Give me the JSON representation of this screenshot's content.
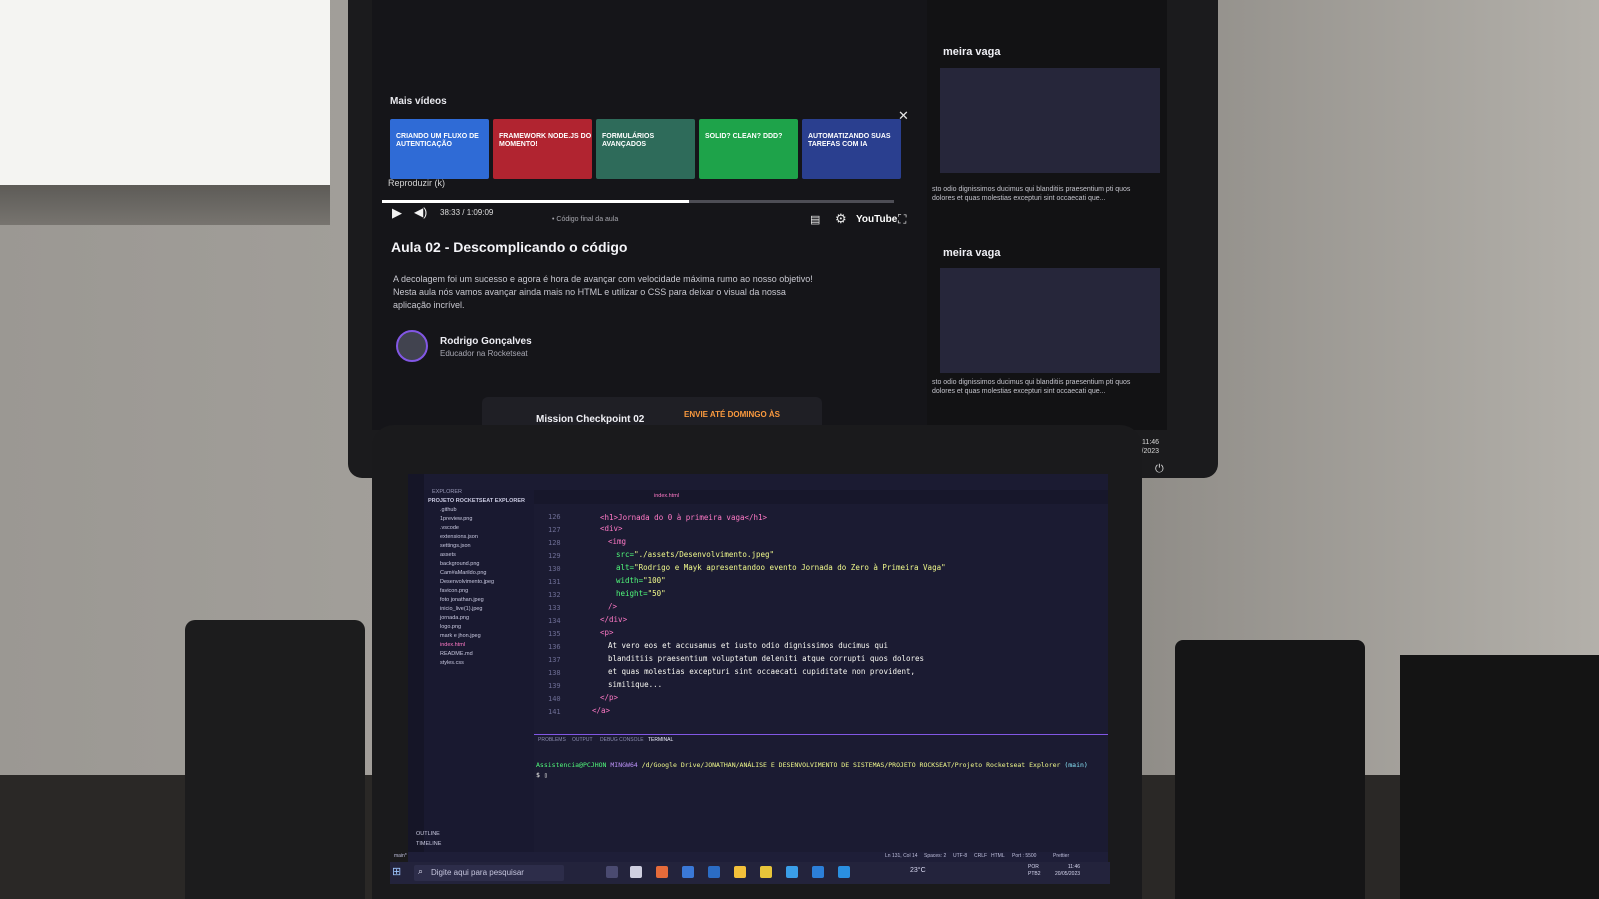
{
  "player": {
    "more_videos": "Mais vídeos",
    "close": "✕",
    "thumbs": [
      {
        "text": "CRIANDO UM FLUXO DE AUTENTICAÇÃO",
        "color": "#2f6bd6"
      },
      {
        "text": "FRAMEWORK NODE.JS DO MOMENTO!",
        "color": "#b12430"
      },
      {
        "text": "FORMULÁRIOS AVANÇADOS",
        "color": "#2e6b5a"
      },
      {
        "text": "SOLID? CLEAN? DDD?",
        "color": "#1ea34a"
      },
      {
        "text": "AUTOMATIZANDO SUAS TAREFAS COM IA",
        "color": "#2a3f8f"
      }
    ],
    "replay": "Reproduzir (k)",
    "progress": 0.6,
    "time": "38:33 / 1:09:09",
    "chapter": "• Código final da aula",
    "brand": "YouTube"
  },
  "lesson": {
    "title": "Aula 02 - Descomplicando o código",
    "description": "A decolagem foi um sucesso e agora é hora de avançar com velocidade máxima rumo ao nosso objetivo! Nesta aula nós vamos avançar ainda mais no HTML e utilizar o CSS para deixar o visual da nossa aplicação incrível.",
    "author": "Rodrigo Gonçalves",
    "role": "Educador na Rocketseat",
    "mission": "Mission Checkpoint 02",
    "badge": "ENVIE ATÉ DOMINGO ÀS"
  },
  "side": {
    "head1": "meira vaga",
    "text1": "sto odio dignissimos ducimus qui blanditiis praesentium pti quos dolores et quas molestias excepturi sint occaecati que...",
    "head2": "meira vaga",
    "text2": "sto odio dignissimos ducimus qui blanditiis praesentium pti quos dolores et quas molestias excepturi sint occaecati que...",
    "time": "11:46",
    "date": "20/05/2023"
  },
  "editor": {
    "explorer": "EXPLORER",
    "project": "PROJETO ROCKETSEAT EXPLORER",
    "tree": [
      ".github",
      "1preview.png",
      ".vscode",
      "extensions.json",
      "settings.json",
      "assets",
      "background.png",
      "Cam#aMarildo.png",
      "Desenvolvimento.jpeg",
      "favicon.png",
      "foto jonathan.jpeg",
      "inicio_live(1).jpeg",
      "jornada.png",
      "logo.png",
      "mark e jhon.jpeg",
      "index.html",
      "README.md",
      "styles.css"
    ],
    "tab": "index.html",
    "lines": [
      "126",
      "127",
      "128",
      "129",
      "130",
      "131",
      "132",
      "133",
      "134",
      "135",
      "136",
      "137",
      "138",
      "139",
      "140",
      "141"
    ],
    "code": {
      "l1": "<h1>Jornada do 0 à primeira vaga</h1>",
      "l2": "<div>",
      "l3": "<img",
      "l4_attr": "src=",
      "l4_val": "\"./assets/Desenvolvimento.jpeg\"",
      "l5_attr": "alt=",
      "l5_val": "\"Rodrigo e Mayk apresentandoo evento Jornada do Zero à Primeira Vaga\"",
      "l6_attr": "width=",
      "l6_val": "\"100\"",
      "l7_attr": "height=",
      "l7_val": "\"50\"",
      "l8": "/>",
      "l9": "</div>",
      "l10": "<p>",
      "l11": "At vero eos et accusamus et iusto odio dignissimos ducimus qui",
      "l12": "blanditiis praesentium voluptatum deleniti atque corrupti quos dolores",
      "l13": "et quas molestias excepturi sint occaecati cupiditate non provident,",
      "l14": "similique...",
      "l15": "</p>",
      "l16": "</a>"
    },
    "panel_tabs": [
      "PROBLEMS",
      "OUTPUT",
      "DEBUG CONSOLE",
      "TERMINAL"
    ],
    "terminal_user": "Assistencia@PCJHON",
    "terminal_env": "MINGW64",
    "terminal_path": "/d/Google Drive/JONATHAN/ANÁLISE E DESENVOLVIMENTO DE SISTEMAS/PROJETO ROCKSEAT/Projeto Rocketseat Explorer",
    "terminal_branch": "(main)",
    "prompt": "$ ▯",
    "outline": "OUTLINE",
    "timeline": "TIMELINE",
    "status_branch": "main*",
    "status_pos": "Ln 131, Col 14",
    "status_spaces": "Spaces: 2",
    "status_enc": "UTF-8",
    "status_eol": "CRLF",
    "status_lang": "HTML",
    "status_port": "Port : 5500",
    "status_prettier": "Prettier"
  },
  "taskbar": {
    "search": "Digite aqui para pesquisar",
    "weather": "23°C",
    "lang1": "POR",
    "lang2": "PTB2",
    "time": "11:46",
    "date": "20/05/2023"
  }
}
